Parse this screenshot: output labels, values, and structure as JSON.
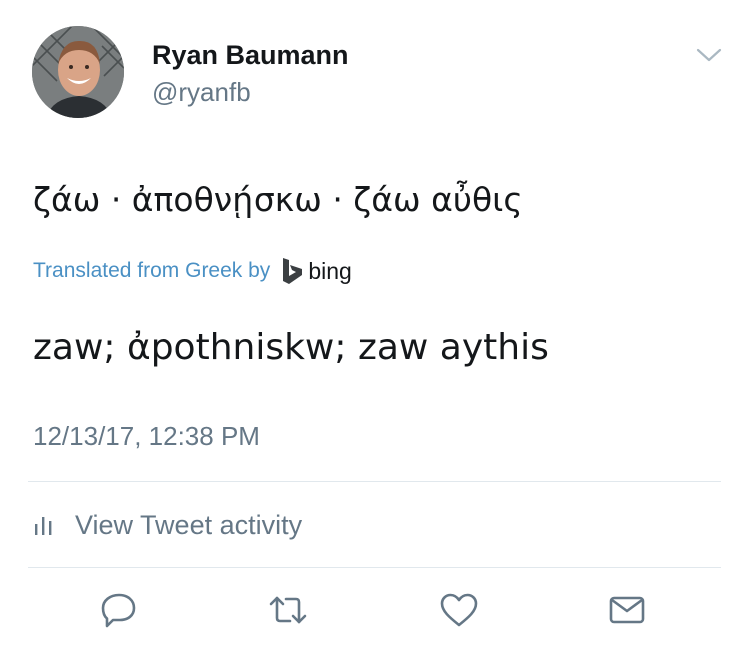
{
  "author": {
    "name": "Ryan Baumann",
    "handle": "@ryanfb"
  },
  "tweet": {
    "text": "ζάω · ἀποθνῄσκω · ζάω αὖθις",
    "translated_label": "Translated from Greek by",
    "translator": "bing",
    "translation": "zaw; ἀpothniskw; zaw aythis",
    "timestamp": "12/13/17, 12:38 PM"
  },
  "activity": {
    "label": "View Tweet activity"
  },
  "icons": {
    "menu": "chevron-down-icon",
    "activity": "bar-chart-icon",
    "reply": "reply-icon",
    "retweet": "retweet-icon",
    "like": "heart-icon",
    "dm": "envelope-icon",
    "translator_logo": "bing-logo-icon"
  },
  "colors": {
    "link": "#4a90c4",
    "secondary_text": "#657786",
    "primary_text": "#14171a",
    "divider": "#e1e8ed"
  }
}
